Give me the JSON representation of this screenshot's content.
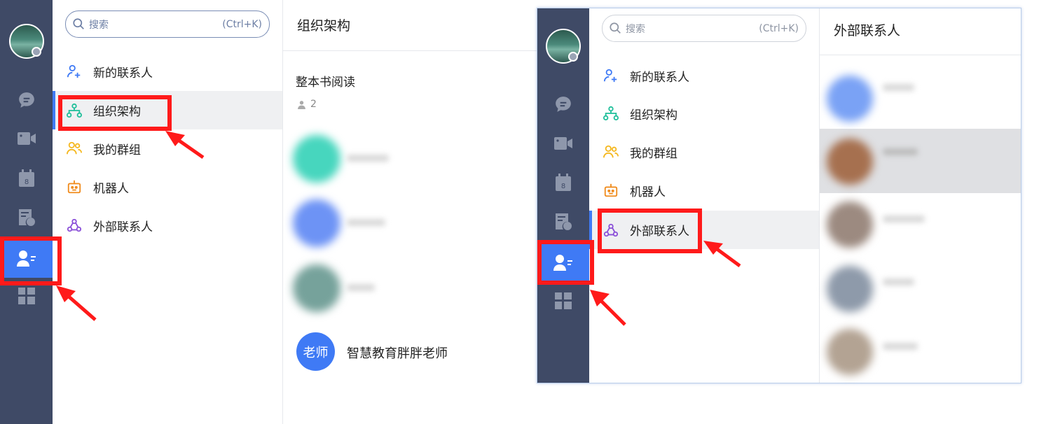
{
  "left": {
    "search": {
      "placeholder": "搜索",
      "hint": "(Ctrl+K)"
    },
    "nav": [
      {
        "label": "新的联系人"
      },
      {
        "label": "组织架构"
      },
      {
        "label": "我的群组"
      },
      {
        "label": "机器人"
      },
      {
        "label": "外部联系人"
      }
    ],
    "main": {
      "title": "组织架构",
      "org_name": "整本书阅读",
      "member_count": "2",
      "contact_avatar_text": "老师",
      "contact_name": "智慧教育胖胖老师"
    }
  },
  "right": {
    "search": {
      "placeholder": "搜索",
      "hint": "(Ctrl+K)"
    },
    "nav": [
      {
        "label": "新的联系人"
      },
      {
        "label": "组织架构"
      },
      {
        "label": "我的群组"
      },
      {
        "label": "机器人"
      },
      {
        "label": "外部联系人"
      }
    ],
    "panel_title": "外部联系人"
  },
  "colors": {
    "rail_bg": "#3f4a66",
    "accent": "#3f7af5",
    "highlight": "#ff1a1a",
    "new_contact": "#3f7af5",
    "org": "#1fbf9a",
    "groups": "#f5b81f",
    "robot": "#f08c1e",
    "external": "#8a4fd8"
  },
  "icons": [
    "chat-icon",
    "video-icon",
    "calendar-icon",
    "docs-icon",
    "contacts-icon",
    "apps-icon"
  ]
}
